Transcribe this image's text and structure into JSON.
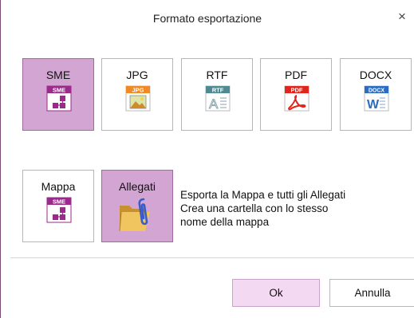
{
  "dialog": {
    "title": "Formato esportazione",
    "close_glyph": "×"
  },
  "formats": [
    {
      "label": "SME",
      "icon": "sme-file-icon",
      "badge": "SME",
      "selected": true
    },
    {
      "label": "JPG",
      "icon": "jpg-file-icon",
      "badge": "JPG",
      "selected": false
    },
    {
      "label": "RTF",
      "icon": "rtf-file-icon",
      "badge": "RTF",
      "selected": false
    },
    {
      "label": "PDF",
      "icon": "pdf-file-icon",
      "badge": "PDF",
      "selected": false
    },
    {
      "label": "DOCX",
      "icon": "docx-file-icon",
      "badge": "DOCX",
      "selected": false
    }
  ],
  "options": [
    {
      "label": "Mappa",
      "icon": "sme-file-icon",
      "badge": "SME",
      "selected": false
    },
    {
      "label": "Allegati",
      "icon": "folder-paperclip-icon",
      "selected": true
    }
  ],
  "description": {
    "lines": [
      "Esporta la Mappa e tutti gli Allegati",
      "Crea una cartella con lo stesso",
      "nome della mappa"
    ]
  },
  "buttons": {
    "ok_label": "Ok",
    "cancel_label": "Annulla"
  },
  "colors": {
    "accent_selected": "#d3a5d3",
    "ok_button_bg": "#f3d9f1",
    "sme_purple": "#9b2a8c",
    "jpg_orange": "#f08a24",
    "rtf_teal": "#4f8a93",
    "pdf_red": "#e0261c",
    "docx_blue": "#2b6cc4",
    "folder_yellow": "#e9b64a",
    "clip_blue": "#3a5cc8"
  }
}
